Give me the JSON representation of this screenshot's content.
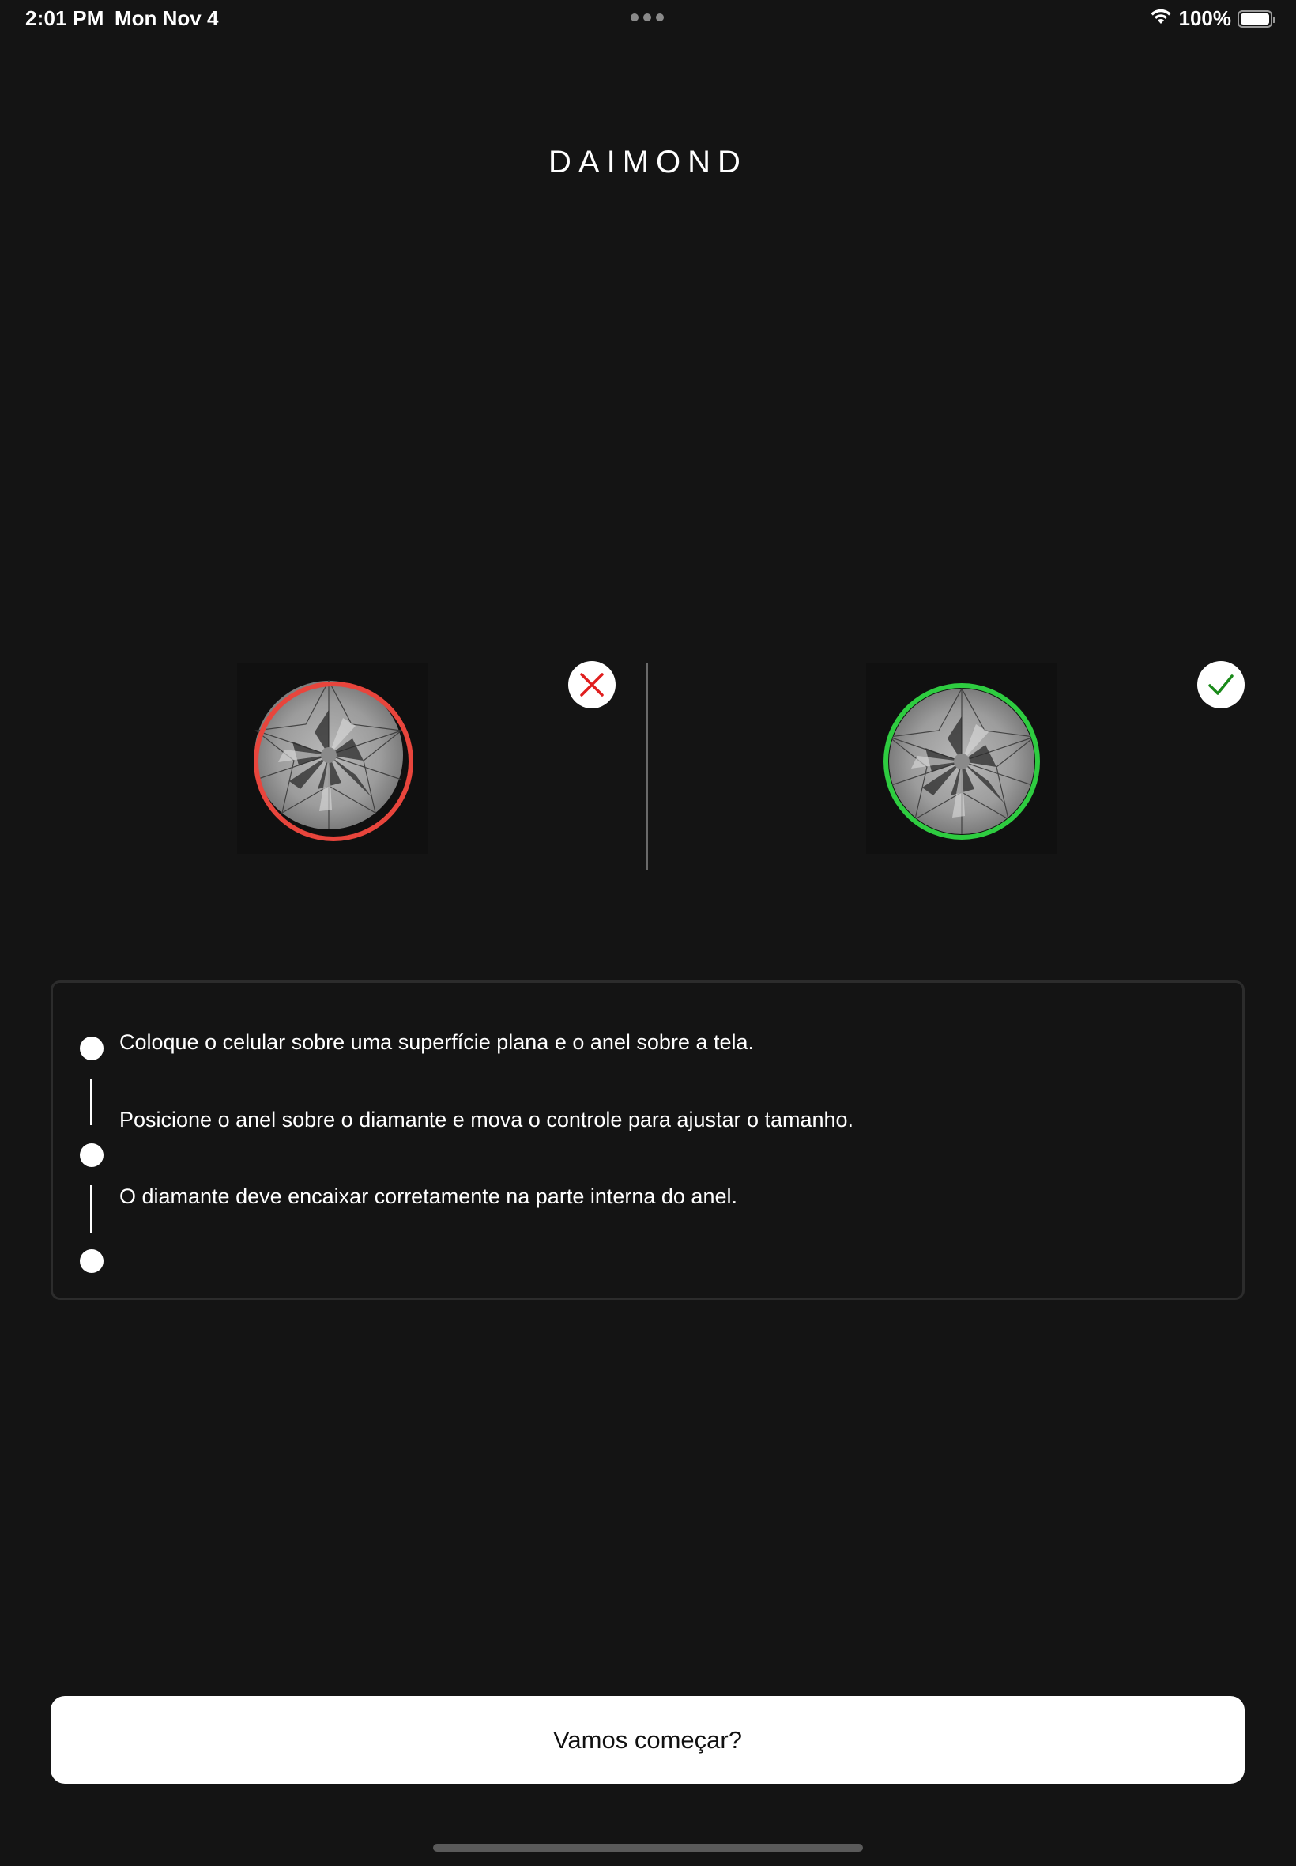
{
  "status_bar": {
    "time": "2:01 PM",
    "date": "Mon Nov 4",
    "battery_percent": "100%",
    "icons": [
      "wifi-icon",
      "battery-icon"
    ]
  },
  "header": {
    "logo": "DAIMOND"
  },
  "comparison": {
    "incorrect": {
      "ring_color": "#e8453c",
      "icon": "x-icon",
      "icon_color": "#e01e1e"
    },
    "correct": {
      "ring_color": "#2ecc40",
      "icon": "check-icon",
      "icon_color": "#1a8a1a"
    }
  },
  "instructions": {
    "steps": [
      {
        "text": "Coloque o celular sobre uma superfície plana e o anel sobre a tela."
      },
      {
        "text": "Posicione o anel sobre o diamante e mova o controle para ajustar o tamanho."
      },
      {
        "text": "O diamante deve encaixar corretamente na parte interna do anel."
      }
    ]
  },
  "cta": {
    "label": "Vamos começar?"
  },
  "colors": {
    "background": "#141414",
    "card_border": "#2c2c2c",
    "button_bg": "#ffffff",
    "button_text": "#111111"
  }
}
